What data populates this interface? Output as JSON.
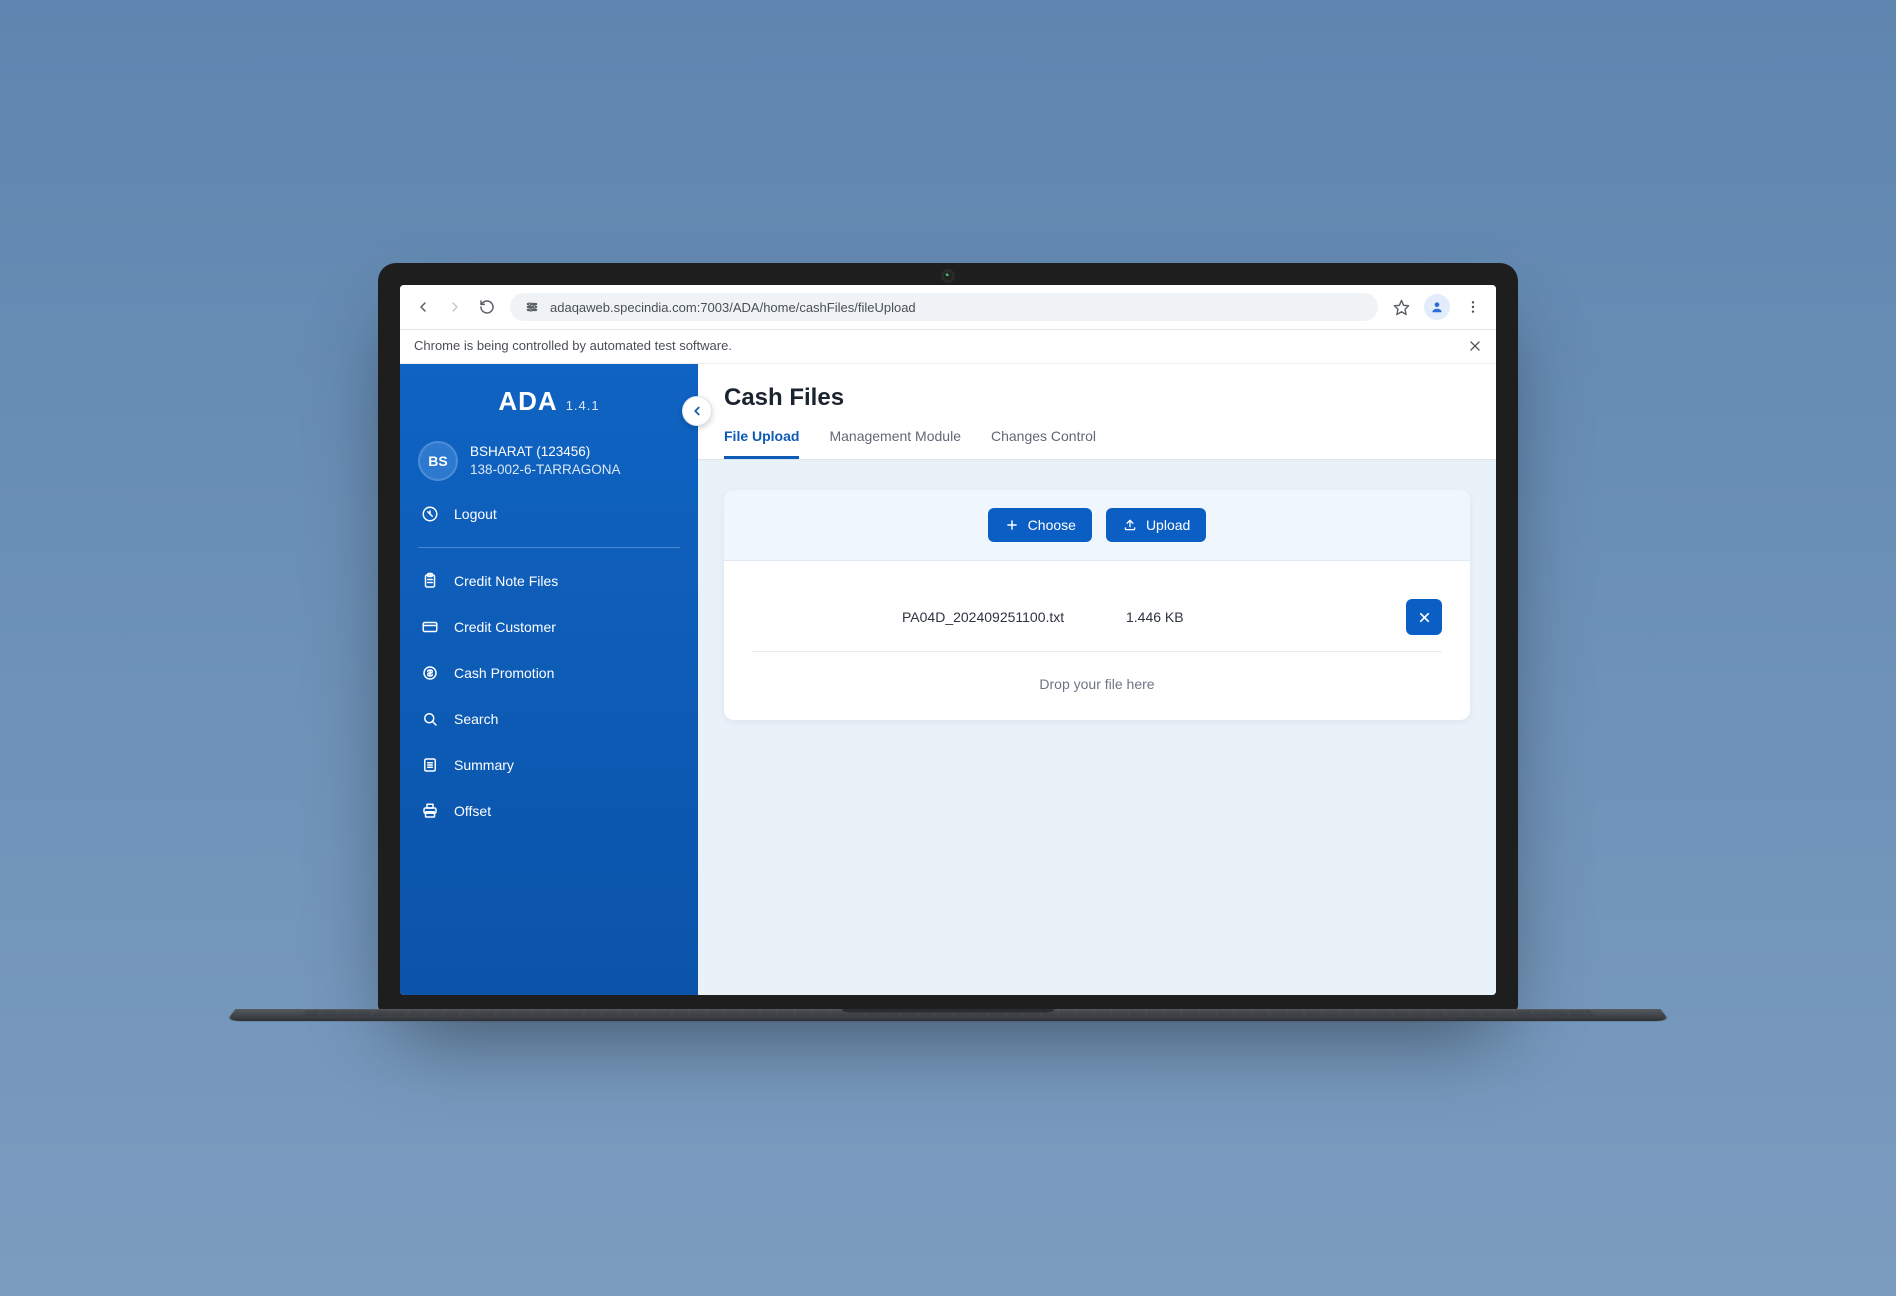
{
  "browser": {
    "url": "adaqaweb.specindia.com:7003/ADA/home/cashFiles/fileUpload",
    "automation_banner": "Chrome is being controlled by automated test software."
  },
  "brand": {
    "name": "ADA",
    "version": "1.4.1"
  },
  "user": {
    "initials": "BS",
    "line1": "BSHARAT (123456)",
    "line2": "138-002-6-TARRAGONA"
  },
  "sidebar": {
    "logout": "Logout",
    "items": [
      {
        "label": "Credit Note Files"
      },
      {
        "label": "Credit Customer"
      },
      {
        "label": "Cash Promotion"
      },
      {
        "label": "Search"
      },
      {
        "label": "Summary"
      },
      {
        "label": "Offset"
      }
    ]
  },
  "main": {
    "title": "Cash Files",
    "tabs": [
      {
        "label": "File Upload",
        "active": true
      },
      {
        "label": "Management Module",
        "active": false
      },
      {
        "label": "Changes Control",
        "active": false
      }
    ],
    "choose_label": "Choose",
    "upload_label": "Upload",
    "selected_file": {
      "name": "PA04D_202409251100.txt",
      "size": "1.446 KB"
    },
    "drop_hint": "Drop your file here"
  }
}
